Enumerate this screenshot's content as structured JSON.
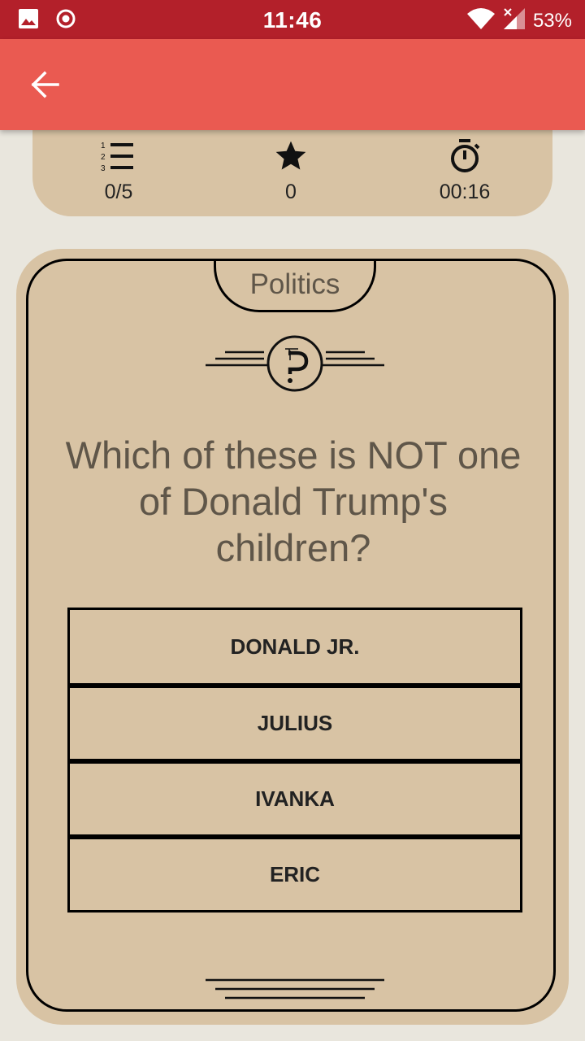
{
  "status_bar": {
    "time": "11:46",
    "battery": "53%",
    "icons": [
      "gallery-icon",
      "record-icon",
      "wifi-icon",
      "signal-icon"
    ]
  },
  "app_bar": {
    "back_icon": "arrow-left-icon",
    "color": "#ea5a51"
  },
  "stats": {
    "questions": {
      "icon": "numbered-list-icon",
      "value": "0/5"
    },
    "score": {
      "icon": "star-icon",
      "value": "0"
    },
    "timer": {
      "icon": "stopwatch-icon",
      "value": "00:16"
    }
  },
  "card": {
    "category": "Politics",
    "logo_icon": "trivia-logo-icon",
    "question": "Which of these is NOT one of Donald Trump's children?",
    "answers": [
      "DONALD JR.",
      "JULIUS",
      "IVANKA",
      "ERIC"
    ]
  },
  "colors": {
    "status_bar": "#b3202a",
    "card": "#d8c3a4",
    "background": "#e9e6dd",
    "question_text": "#5f5649"
  }
}
